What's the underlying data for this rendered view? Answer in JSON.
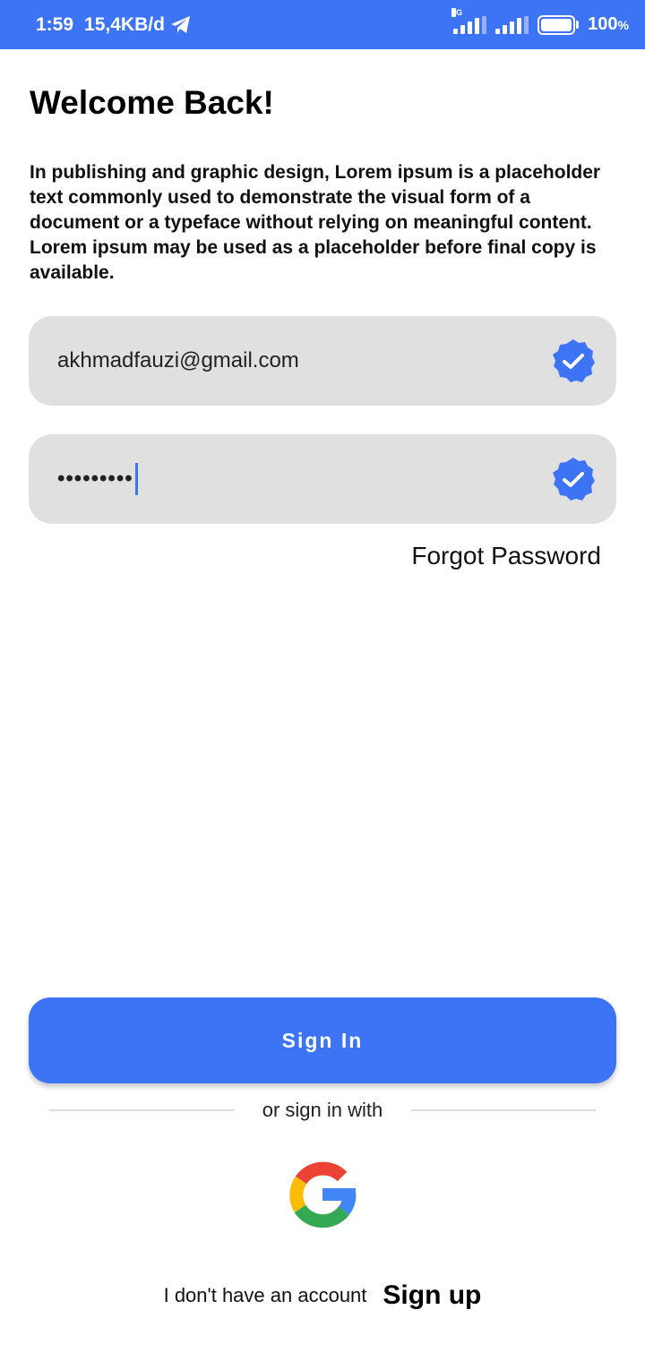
{
  "status_bar": {
    "time": "1:59",
    "speed": "15,4KB/d",
    "network_type": "4G",
    "battery": "100",
    "battery_unit": "%"
  },
  "page": {
    "title": "Welcome Back!",
    "description": "In publishing and graphic design, Lorem ipsum is a placeholder text commonly used to demonstrate the visual form of a document or a typeface without relying on meaningful content. Lorem ipsum may be used as a placeholder before final copy is available."
  },
  "form": {
    "email_value": "akhmadfauzi@gmail.com",
    "password_masked": "•••••••••",
    "forgot_label": "Forgot Password"
  },
  "actions": {
    "sign_in_label": "Sign In",
    "or_sign_in_with": "or sign in with",
    "no_account_text": "I don't have an account",
    "sign_up_label": "Sign up"
  },
  "colors": {
    "accent": "#3d74f5",
    "field_bg": "#e0e0e0"
  },
  "icons": {
    "check_icon": "check-badge-icon",
    "telegram_icon": "telegram-icon",
    "google_icon": "google-icon"
  }
}
